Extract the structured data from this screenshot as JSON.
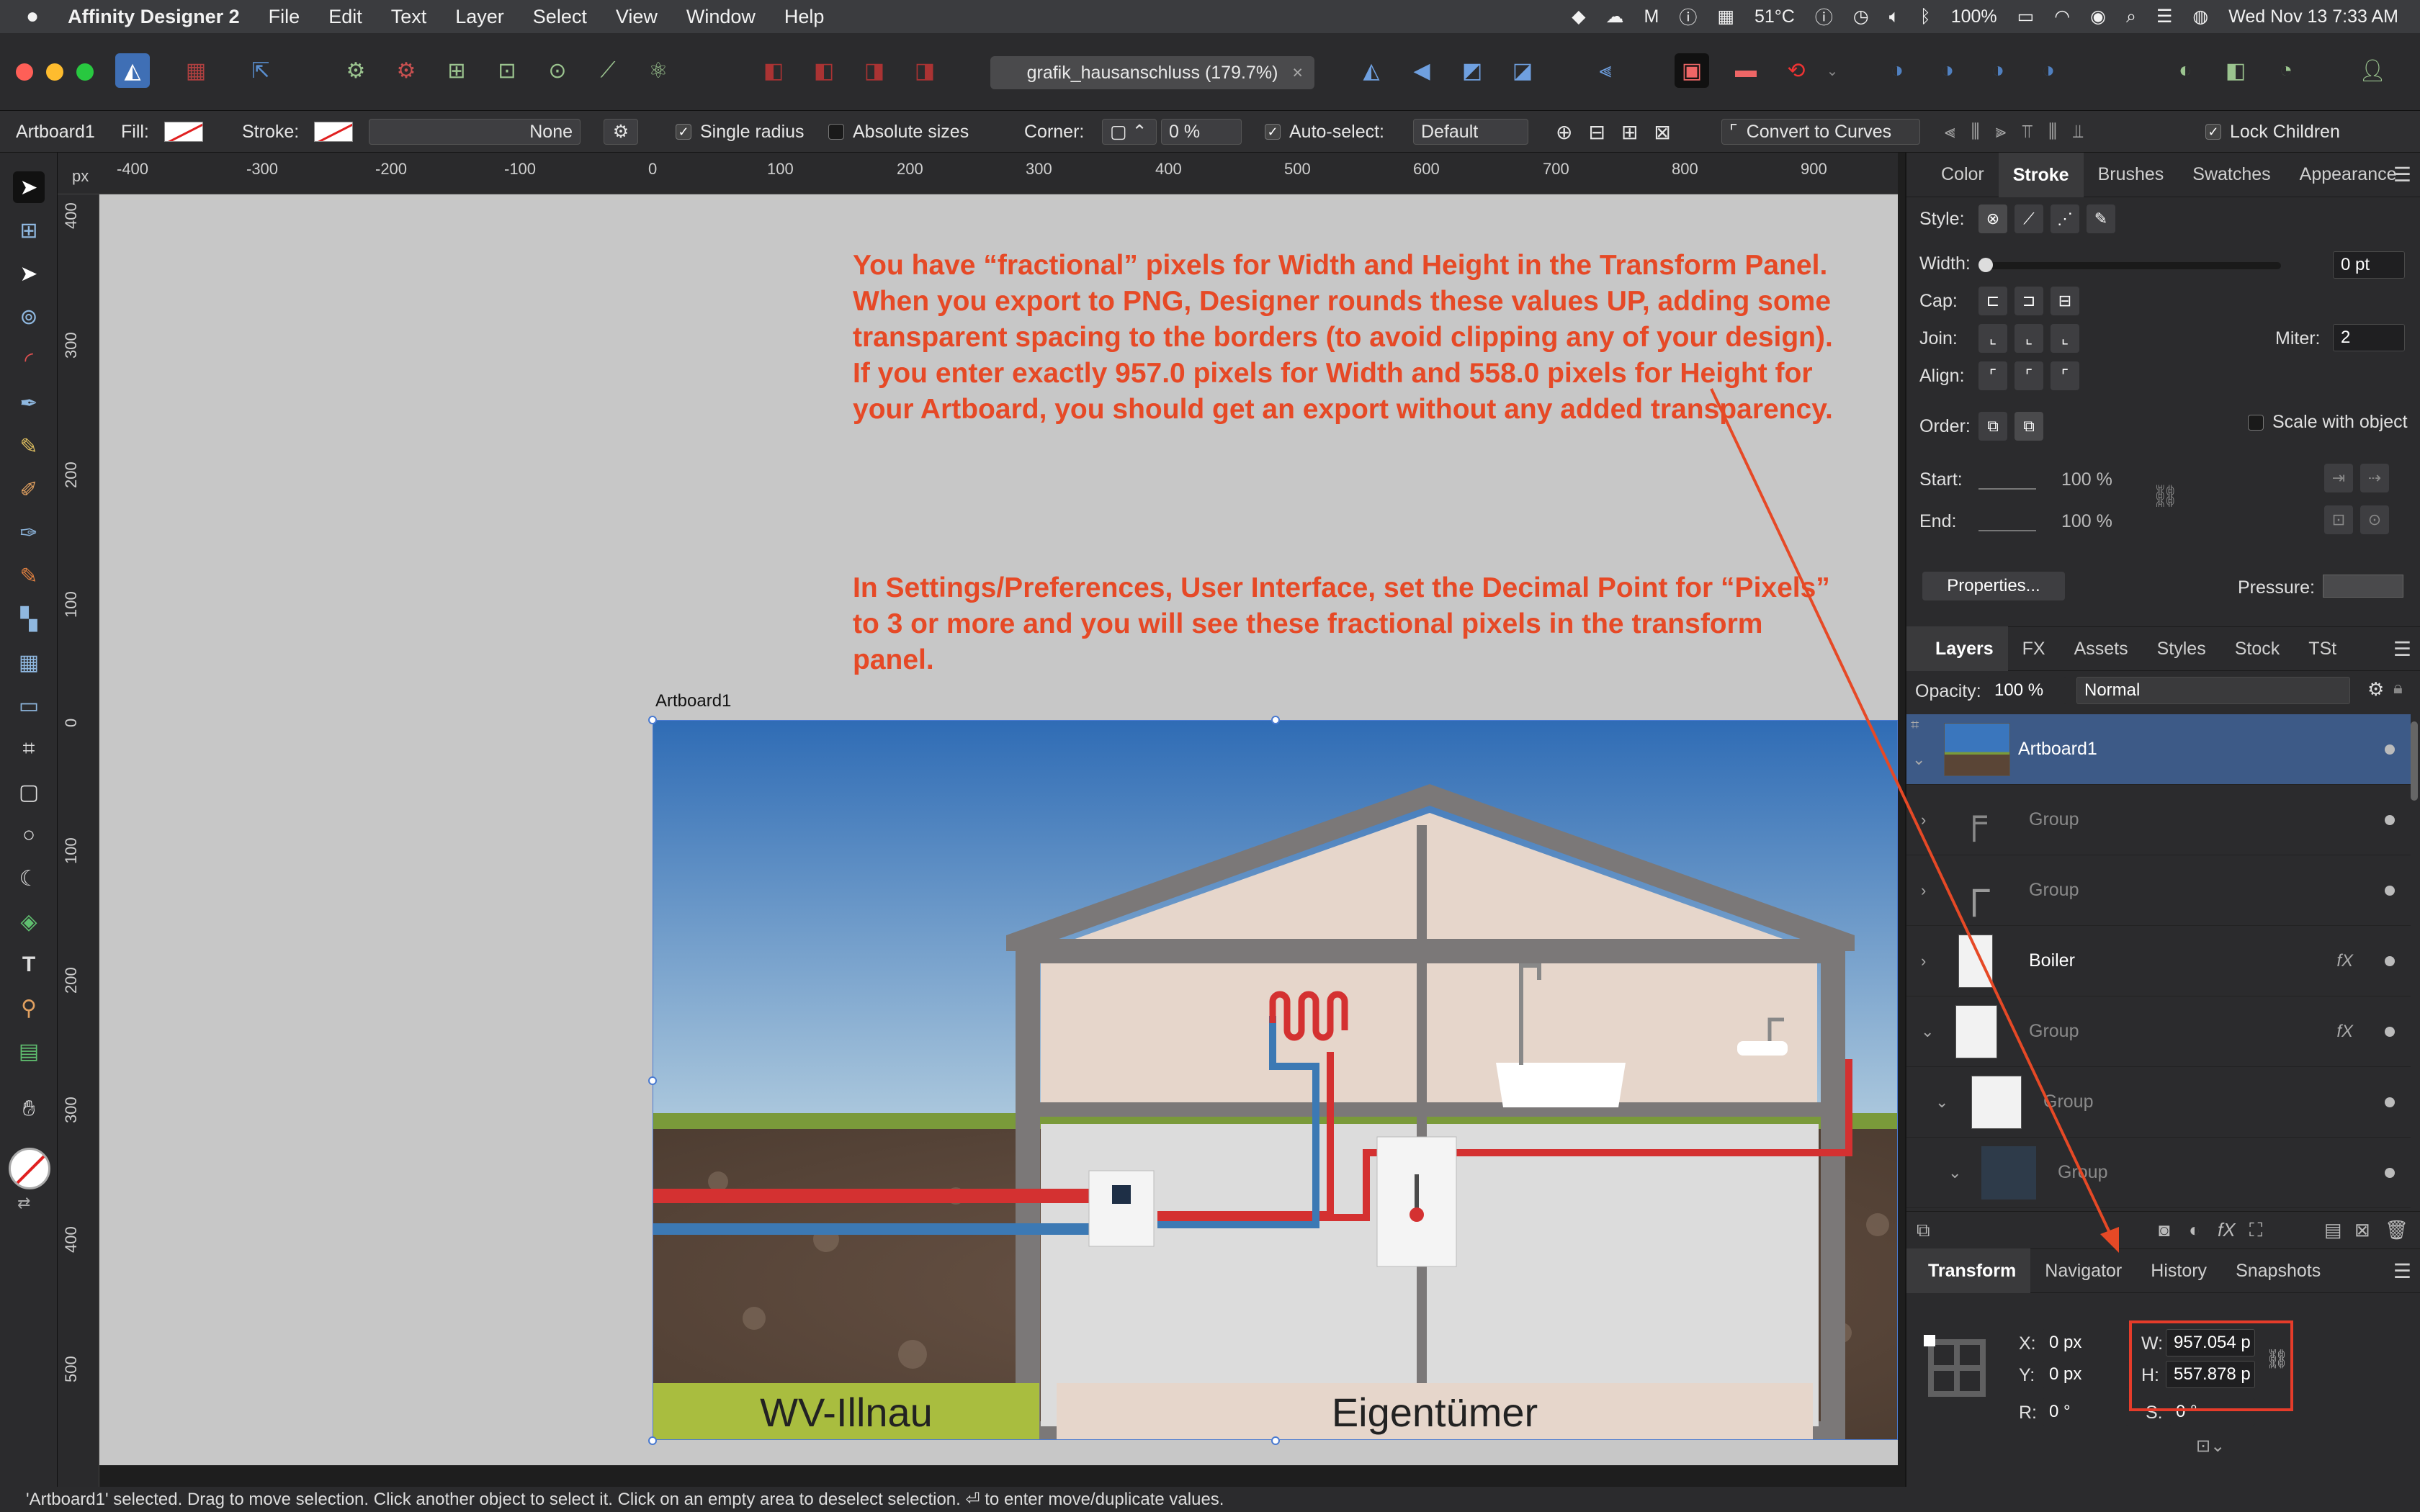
{
  "menubar": {
    "app_name": "Affinity Designer 2",
    "items": [
      "File",
      "Edit",
      "Text",
      "Layer",
      "Select",
      "View",
      "Window",
      "Help"
    ],
    "temperature": "51°C",
    "battery": "100%",
    "datetime": "Wed Nov 13  7:33 AM"
  },
  "toolbar": {
    "document_tab": "grafik_hausanschluss (179.7%)",
    "tab_close": "×"
  },
  "context": {
    "selection_name": "Artboard1",
    "fill_label": "Fill:",
    "stroke_label": "Stroke:",
    "stroke_style": "None",
    "single_radius": "Single radius",
    "absolute_sizes": "Absolute sizes",
    "corner_label": "Corner:",
    "corner_value": "0 %",
    "auto_select_label": "Auto-select:",
    "auto_select_value": "Default",
    "convert_to_curves": "Convert to Curves",
    "lock_children": "Lock Children"
  },
  "ruler": {
    "unit": "px",
    "h_ticks": [
      "-400",
      "-300",
      "-200",
      "-100",
      "0",
      "100",
      "200",
      "300",
      "400",
      "500",
      "600",
      "700",
      "800",
      "900"
    ],
    "v_ticks": [
      "400",
      "300",
      "200",
      "100",
      "0",
      "100",
      "200",
      "300",
      "400",
      "500"
    ]
  },
  "annotation": {
    "paragraph1": "You have “fractional” pixels for Width and Height in the Transform Panel. When you export to PNG, Designer rounds these values UP, adding some transparent spacing to the borders (to avoid clipping any of your design). If you enter exactly 957.0 pixels for Width and 558.0 pixels for Height for your Artboard, you should get an export without any added transparency.",
    "paragraph2": "In Settings/Preferences, User Interface, set the Decimal Point for “Pixels” to 3 or more and you will see these fractional pixels in the transform panel.",
    "color": "#e64926"
  },
  "artboard": {
    "label": "Artboard1",
    "left_label": "WV-Illnau",
    "right_label": "Eigentümer"
  },
  "stroke_panel": {
    "tabs": [
      "Color",
      "Stroke",
      "Brushes",
      "Swatches",
      "Appearance"
    ],
    "active_tab": "Stroke",
    "style_label": "Style:",
    "width_label": "Width:",
    "width_value": "0 pt",
    "cap_label": "Cap:",
    "join_label": "Join:",
    "miter_label": "Miter:",
    "miter_value": "2",
    "align_label": "Align:",
    "order_label": "Order:",
    "scale_with_object": "Scale with object",
    "start_label": "Start:",
    "start_value": "100 %",
    "end_label": "End:",
    "end_value": "100 %",
    "properties_button": "Properties...",
    "pressure_label": "Pressure:"
  },
  "layers_panel": {
    "tabs": [
      "Layers",
      "FX",
      "Assets",
      "Styles",
      "Stock",
      "TSt"
    ],
    "active_tab": "Layers",
    "opacity_label": "Opacity:",
    "opacity_value": "100 %",
    "blend_mode": "Normal",
    "rows": [
      {
        "name": "Artboard1",
        "selected": true,
        "fx": false,
        "indent": 0
      },
      {
        "name": "Group",
        "selected": false,
        "fx": false,
        "indent": 0
      },
      {
        "name": "Group",
        "selected": false,
        "fx": false,
        "indent": 0
      },
      {
        "name": "Boiler",
        "selected": false,
        "fx": true,
        "indent": 0
      },
      {
        "name": "Group",
        "selected": false,
        "fx": true,
        "indent": 0
      },
      {
        "name": "Group",
        "selected": false,
        "fx": false,
        "indent": 1
      },
      {
        "name": "Group",
        "selected": false,
        "fx": false,
        "indent": 2
      }
    ]
  },
  "transform_panel": {
    "tabs": [
      "Transform",
      "Navigator",
      "History",
      "Snapshots"
    ],
    "active_tab": "Transform",
    "x_label": "X:",
    "x_value": "0 px",
    "y_label": "Y:",
    "y_value": "0 px",
    "w_label": "W:",
    "w_value": "957.054 p",
    "h_label": "H:",
    "h_value": "557.878 p",
    "r_label": "R:",
    "r_value": "0 °",
    "s_label": "S:",
    "s_value": "0 °"
  },
  "status": {
    "message": "'Artboard1' selected. Drag to move selection. Click another object to select it. Click on an empty area to deselect selection. ⏎ to enter move/duplicate values."
  }
}
